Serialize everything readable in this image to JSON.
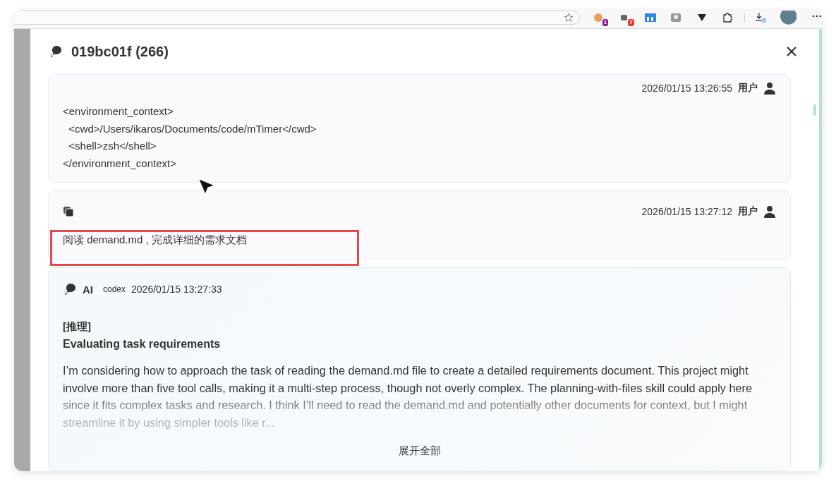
{
  "browser": {
    "extensions": [
      {
        "kind": "cookie",
        "badge": "1",
        "color": "#8e1b9c"
      },
      {
        "kind": "square",
        "badge": "7",
        "color": "#e8392f"
      },
      {
        "kind": "board"
      },
      {
        "kind": "camera"
      },
      {
        "kind": "triangle"
      },
      {
        "kind": "puzzle"
      }
    ]
  },
  "dialog": {
    "title": "019bc01f (266)",
    "messages": [
      {
        "kind": "user",
        "author": "用户",
        "time": "2026/01/15 13:26:55",
        "copyable": false,
        "highlighted": false,
        "text": "<environment_context>\n  <cwd>/Users/ikaros/Documents/code/mTimer</cwd>\n  <shell>zsh</shell>\n</environment_context>"
      },
      {
        "kind": "user",
        "author": "用户",
        "time": "2026/01/15 13:27:12",
        "copyable": true,
        "highlighted": true,
        "text": "阅读 demand.md , 完成详细的需求文档"
      },
      {
        "kind": "ai",
        "author": "AI",
        "model": "codex",
        "time": "2026/01/15 13:27:33",
        "tag": "[推理]",
        "heading": "Evaluating task requirements",
        "collapsed": true,
        "text": "I’m considering how to approach the task of reading the demand.md file to create a detailed requirements document. This project might involve more than five tool calls, making it a multi-step process, though not overly complex. The planning-with-files skill could apply here since it fits complex tasks and research. I think I’ll need to read the demand.md and potentially other documents for context, but I might streamline it by using simpler tools like r...",
        "expand_label": "展开全部"
      }
    ]
  }
}
